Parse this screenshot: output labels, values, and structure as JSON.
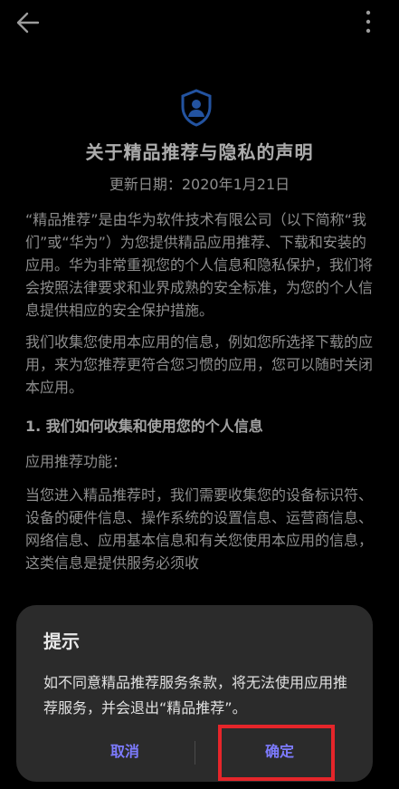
{
  "header": {
    "back_icon": "back-arrow-icon",
    "more_icon": "more-vert-icon"
  },
  "main": {
    "shield_icon": "privacy-shield-icon",
    "title": "关于精品推荐与隐私的声明",
    "updated": "更新日期：2020年1月21日",
    "paragraphs": [
      "“精品推荐”是由华为软件技术有限公司（以下简称“我们”或“华为”）为您提供精品应用推荐、下载和安装的应用。华为非常重视您的个人信息和隐私保护，我们将会按照法律要求和业界成熟的安全标准，为您的个人信息提供相应的安全保护措施。",
      "我们收集您使用本应用的信息，例如您所选择下载的应用，来为您推荐更符合您习惯的应用，您可以随时关闭本应用。"
    ],
    "section_heading": "1. 我们如何收集和使用您的个人信息",
    "section_sub": "应用推荐功能：",
    "section_body": "当您进入精品推荐时，我们需要收集您的设备标识符、设备的硬件信息、操作系统的设置信息、运营商信息、网络信息、应用基本信息和有关您使用本应用的信息，这类信息是提供服务必须收"
  },
  "dialog": {
    "title": "提示",
    "message": "如不同意精品推荐服务条款，将无法使用应用推荐服务，并会退出“精品推荐”。",
    "cancel_label": "取消",
    "confirm_label": "确定"
  },
  "colors": {
    "accent": "#7d7bff",
    "highlight": "#e5252a",
    "shield": "#2f6fd6"
  }
}
